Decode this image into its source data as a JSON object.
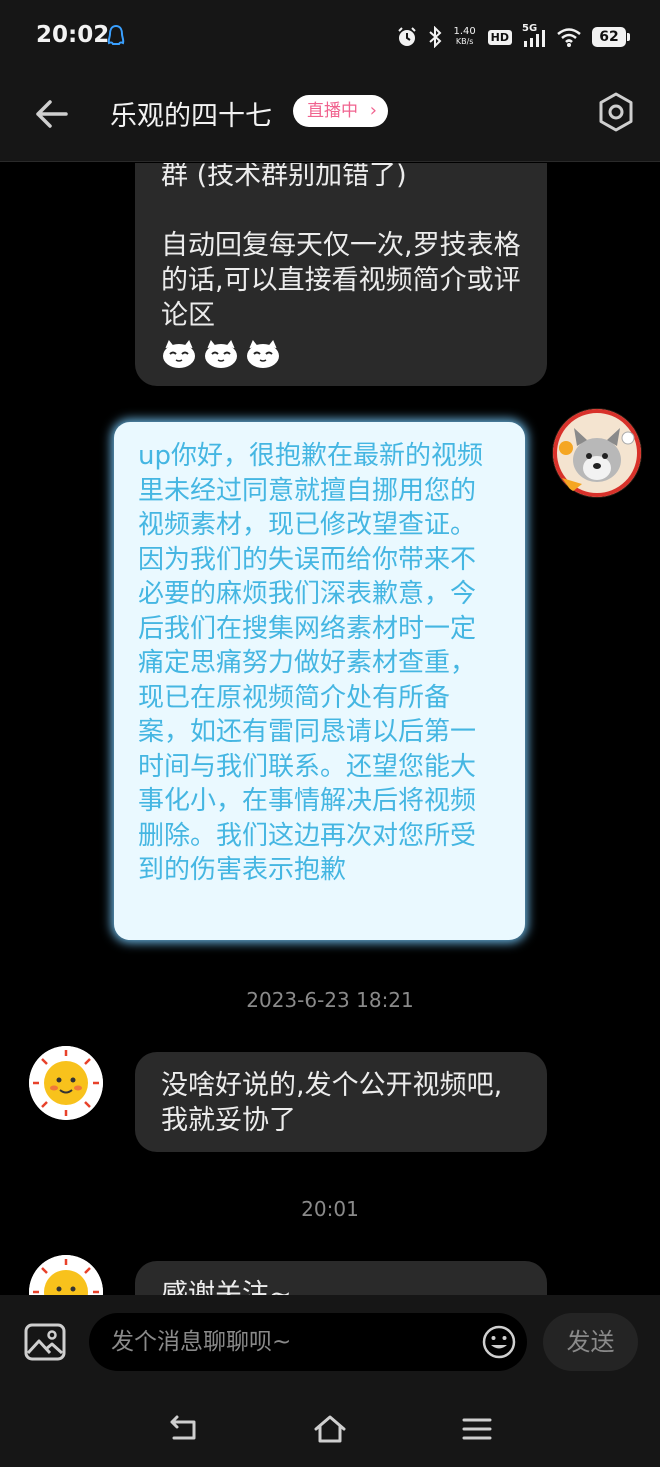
{
  "status_bar": {
    "time": "20:02",
    "net_speed_value": "1.40",
    "net_speed_unit": "KB/s",
    "hd_label": "HD",
    "network_label": "5G",
    "battery_level": "62"
  },
  "header": {
    "title": "乐观的四十七",
    "live_badge": "直播中",
    "live_chevron": "›"
  },
  "messages": {
    "incoming_top": {
      "line1": "群 (技术群别加错了)",
      "line2": "自动回复每天仅一次,罗技表格的话,可以直接看视频简介或评论区",
      "emoji_icons": [
        "cat-face-emoji",
        "cat-face-emoji",
        "cat-face-emoji"
      ]
    },
    "outgoing": {
      "text": "up你好，很抱歉在最新的视频里未经过同意就擅自挪用您的视频素材，现已修改望查证。因为我们的失误而给你带来不必要的麻烦我们深表歉意，今后我们在搜集网络素材时一定痛定思痛努力做好素材查重，现已在原视频简介处有所备案，如还有雷同恳请以后第一时间与我们联系。还望您能大事化小，在事情解决后将视频删除。我们这边再次对您所受到的伤害表示抱歉"
    },
    "timestamp_1": "2023-6-23 18:21",
    "incoming_reply": {
      "text": "没啥好说的,发个公开视频吧,我就妥协了"
    },
    "timestamp_2": "20:01",
    "incoming_partial": {
      "text": "感谢关注~"
    }
  },
  "input_bar": {
    "placeholder": "发个消息聊聊呗~",
    "send_label": "发送"
  },
  "colors": {
    "background": "#000000",
    "bar_background": "#161616",
    "incoming_bubble": "#2a2a2a",
    "outgoing_bubble": "#eaf9ff",
    "outgoing_text": "#45b6e2",
    "live_badge_text": "#f0638f"
  }
}
